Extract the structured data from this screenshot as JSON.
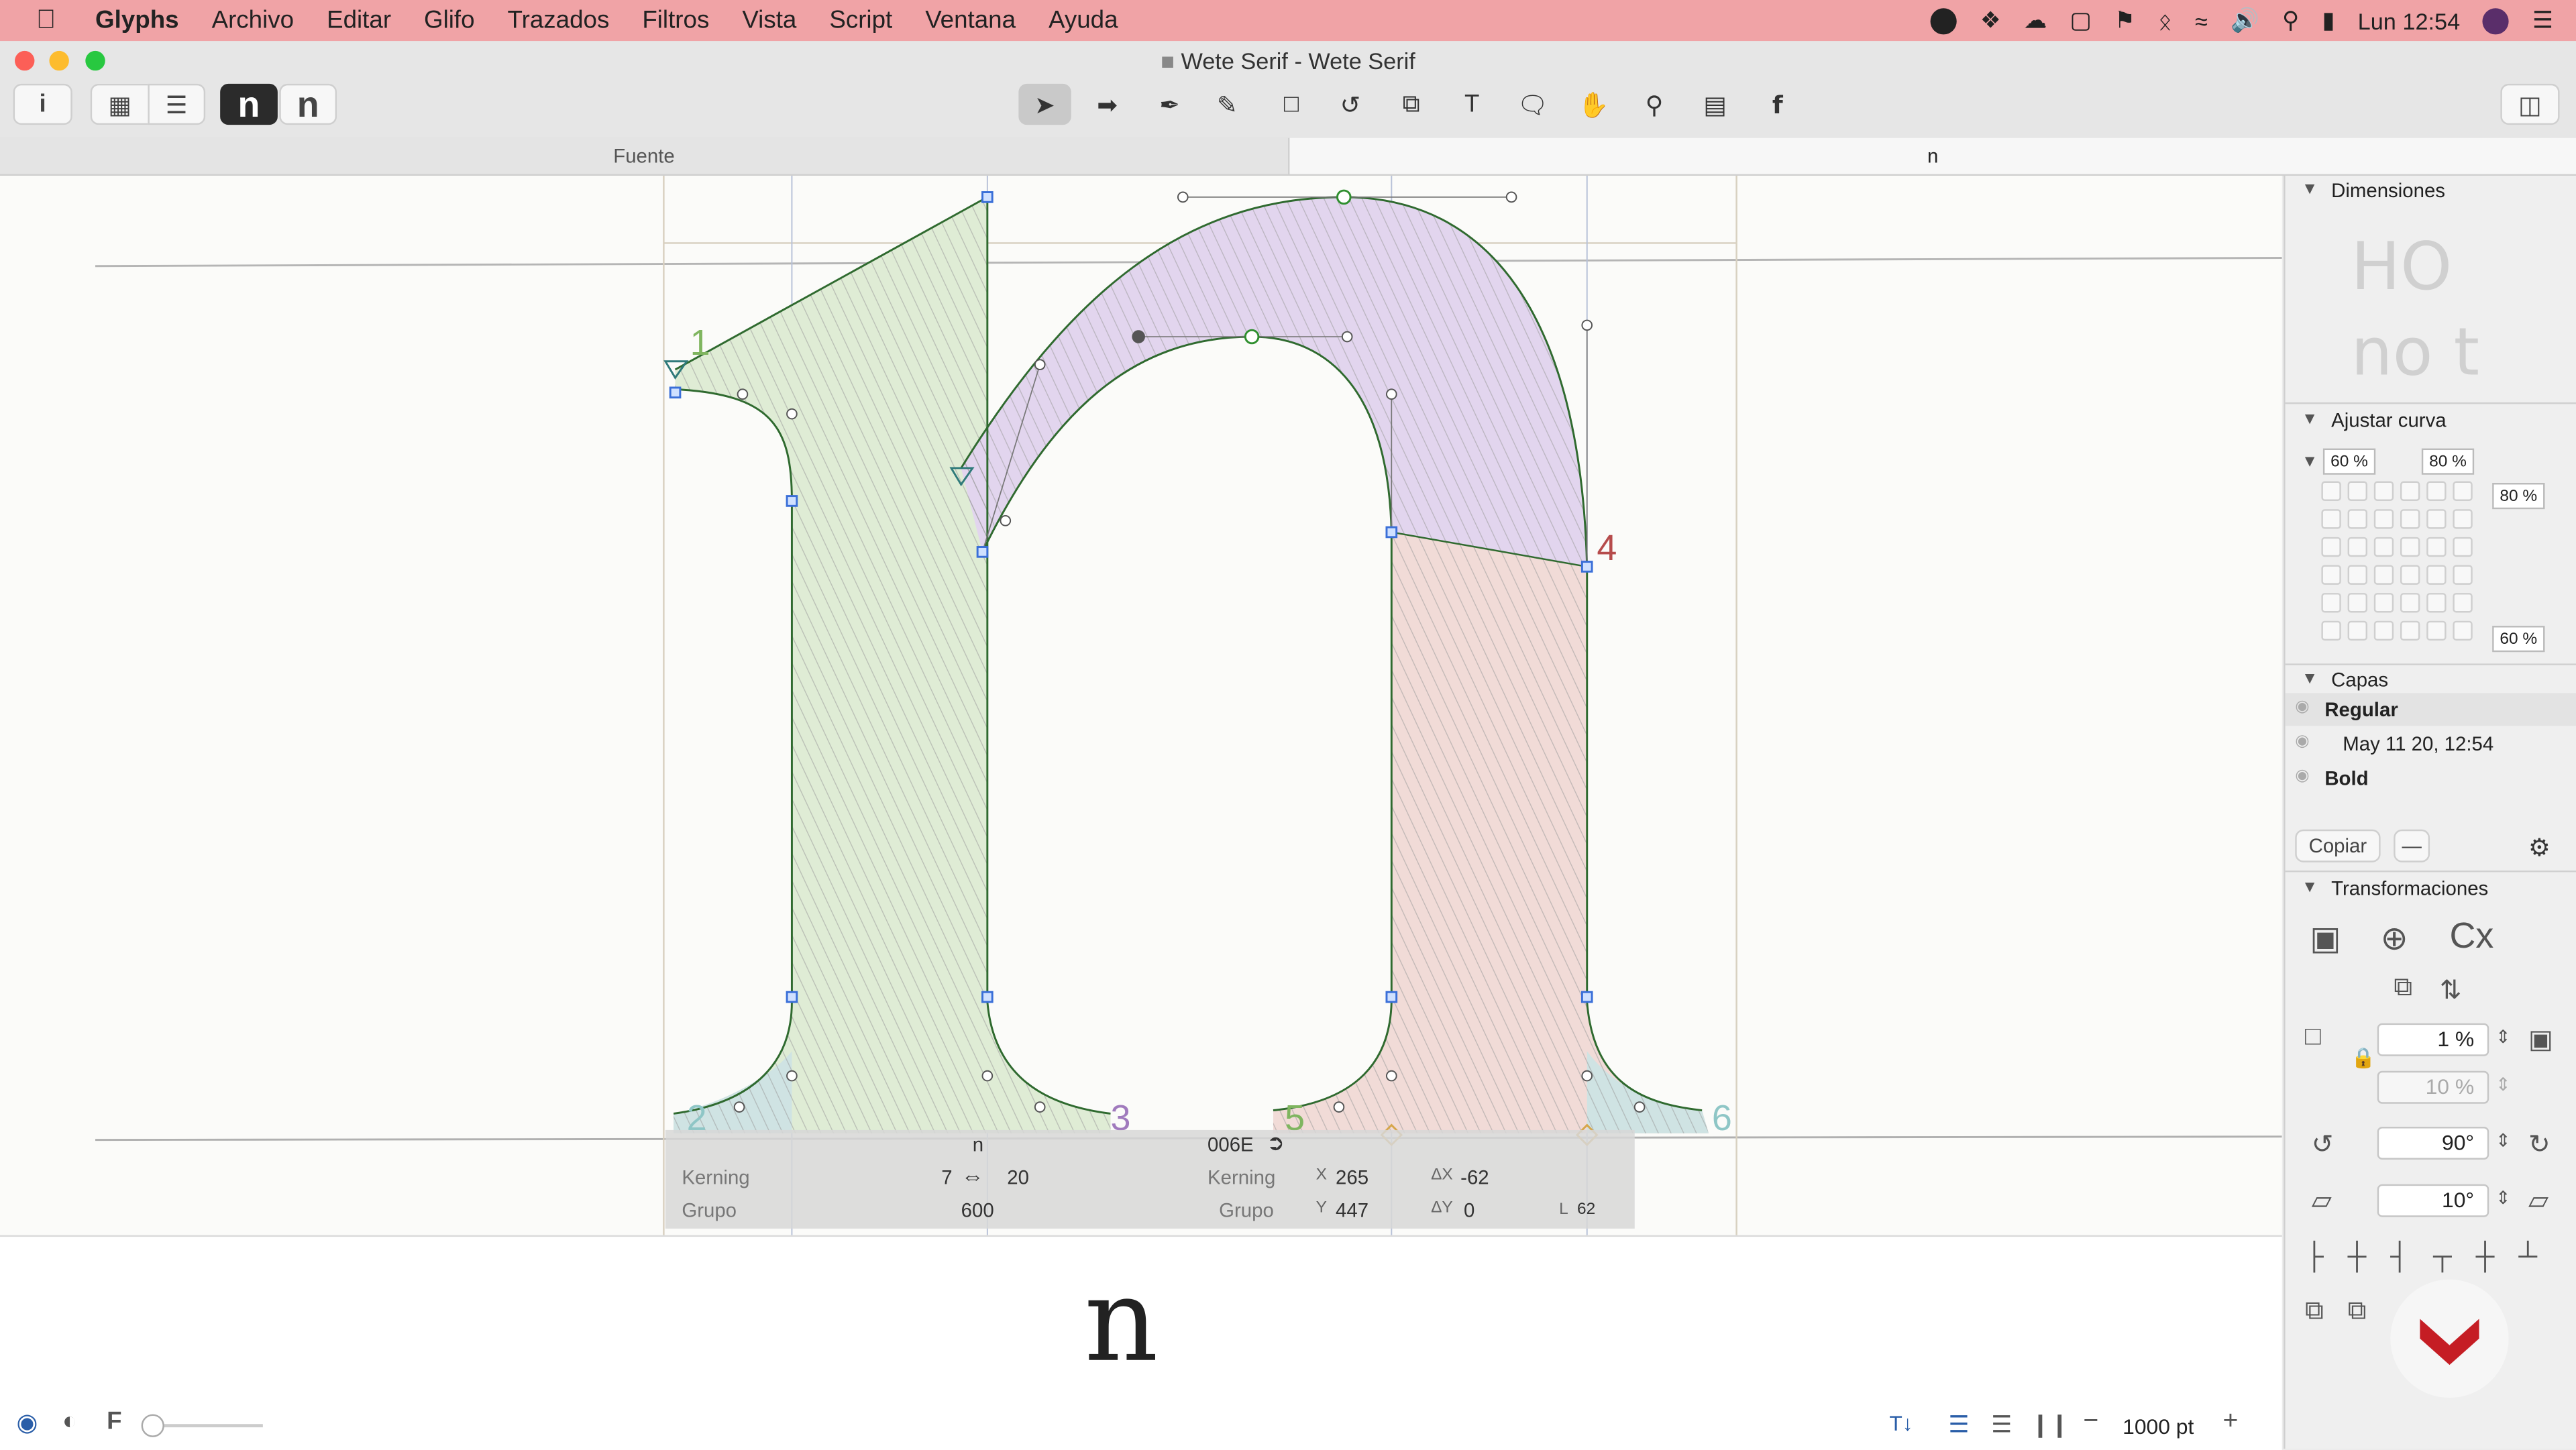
{
  "menubar": {
    "items": [
      "Glyphs",
      "Archivo",
      "Editar",
      "Glifo",
      "Trazados",
      "Filtros",
      "Vista",
      "Script",
      "Ventana",
      "Ayuda"
    ],
    "clock": "Lun 12:54"
  },
  "window": {
    "title": "Wete Serif - Wete Serif",
    "glyph_buttons": [
      "n",
      "n"
    ]
  },
  "tabs": {
    "font_tab": "Fuente",
    "glyph_tab": "n"
  },
  "canvas": {
    "node_numbers": [
      "1",
      "2",
      "3",
      "4",
      "5",
      "6"
    ],
    "info": {
      "glyph_name": "n",
      "unicode": "006E",
      "kerning_label": "Kerning",
      "group_label": "Grupo",
      "kern_left": "7",
      "kern_right": "20",
      "width": "600",
      "x_label": "X",
      "x_value": "265",
      "y_label": "Y",
      "y_value": "447",
      "dx_label": "ΔX",
      "dx_value": "-62",
      "dy_label": "ΔY",
      "dy_value": "0",
      "l_label": "L",
      "l_value": "62"
    }
  },
  "preview": {
    "glyph": "n",
    "zoom": "1000 pt"
  },
  "sidebar": {
    "dimensions_title": "Dimensiones",
    "curve_title": "Ajustar curva",
    "curve_values": {
      "top_left": "60 %",
      "top_right": "80 %",
      "right_top": "80 %",
      "right_bottom": "60 %"
    },
    "layers_title": "Capas",
    "layers": [
      {
        "name": "Regular",
        "type": "master"
      },
      {
        "name": "May 11 20, 12:54",
        "type": "backup"
      },
      {
        "name": "Bold",
        "type": "master"
      }
    ],
    "copy_button": "Copiar",
    "transform_title": "Transformaciones",
    "scale_value": "1 %",
    "scale_value2": "10 %",
    "rotate_value": "90°",
    "slant_value": "10°"
  },
  "colors": {
    "menubar": "#f0a3a6",
    "green_shape": "#dfecd5",
    "purple_shape": "#e2d5ee",
    "pink_shape": "#f1dbd7",
    "node_blue": "#3a6fd8",
    "logo_red": "#c51d24"
  }
}
